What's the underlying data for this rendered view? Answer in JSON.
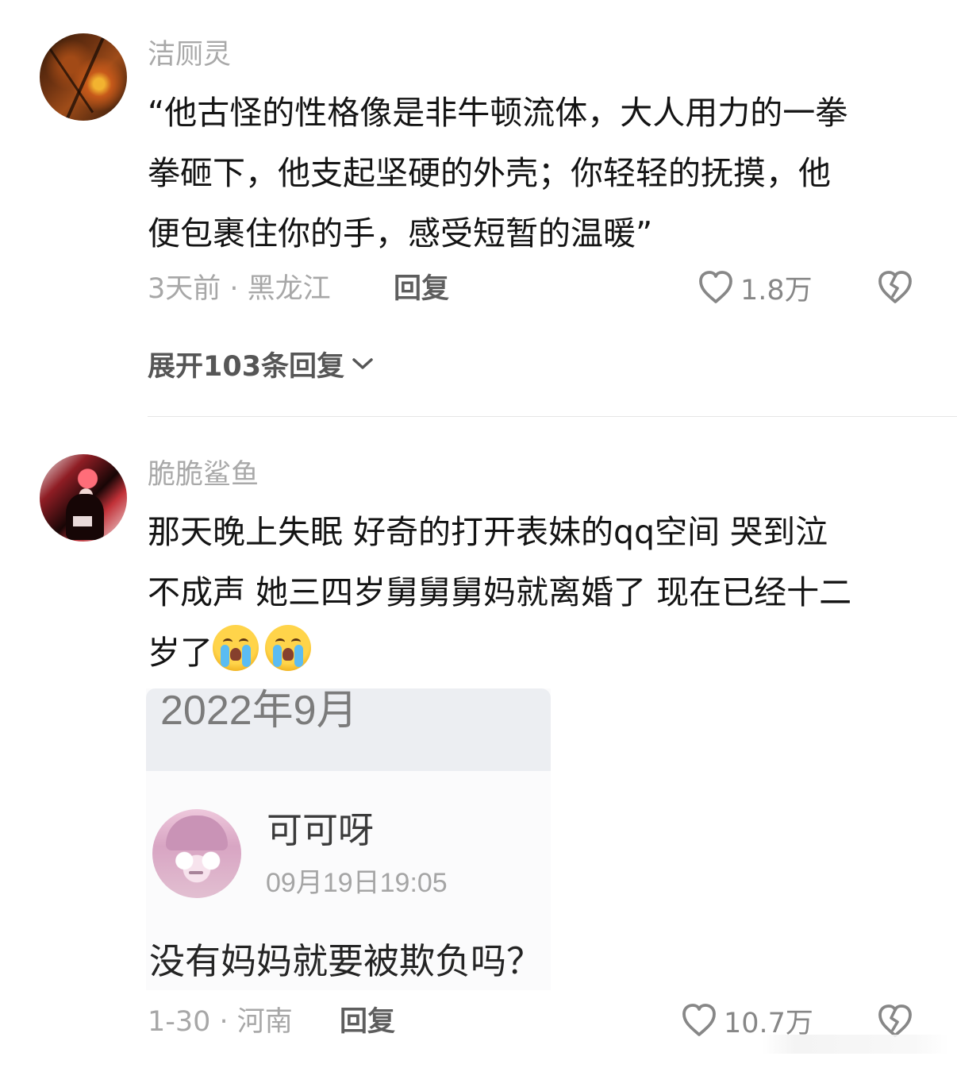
{
  "comments": [
    {
      "username": "洁厕灵",
      "lines": [
        "“他古怪的性格像是非牛顿流体，大人用力的一拳",
        "拳砸下，他支起坚硬的外壳；你轻轻的抚摸，他",
        "便包裹住你的手，感受短暂的温暖”"
      ],
      "meta": "3天前 · 黑龙江",
      "reply_label": "回复",
      "likes": "1.8万",
      "expand_label": "展开103条回复"
    },
    {
      "username": "脆脆鲨鱼",
      "lines": [
        "那天晚上失眠 好奇的打开表妹的qq空间 哭到泣",
        "不成声 她三四岁舅舅舅妈就离婚了 现在已经十二",
        "岁了"
      ],
      "emoji_names": [
        "crying-face",
        "crying-face"
      ],
      "embedded_screenshot": {
        "date": "2022年9月",
        "name": "可可呀",
        "time": "09月19日19:05",
        "question": "没有妈妈就要被欺负吗？"
      },
      "meta": "1-30 · 河南",
      "reply_label": "回复",
      "likes": "10.7万"
    }
  ],
  "icons": {
    "like": "heart-outline-icon",
    "dislike": "broken-heart-icon",
    "expand": "chevron-down-icon"
  },
  "colors": {
    "username": "#a9a9a9",
    "comment_text": "#141414",
    "meta": "#a7a7a7",
    "reply": "#5e5e5e",
    "icon": "#878787",
    "divider": "#e5e5e5"
  }
}
